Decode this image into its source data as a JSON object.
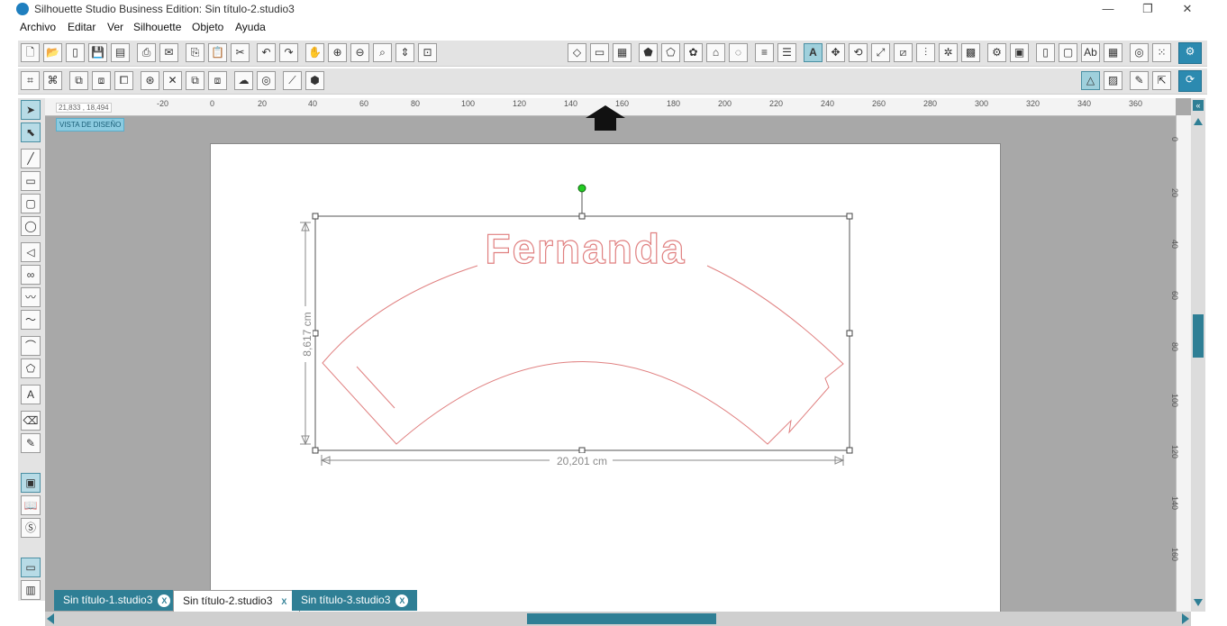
{
  "window": {
    "title": "Silhouette Studio Business Edition: Sin título-2.studio3",
    "minimize": "—",
    "restore": "❐",
    "close": "✕"
  },
  "menu": [
    "Archivo",
    "Editar",
    "Ver",
    "Silhouette",
    "Objeto",
    "Ayuda"
  ],
  "canvas": {
    "design_view_badge": "VISTA DE DISEÑO",
    "coords": "21,833 , 18,494",
    "ruler_h_labels": [
      "-20",
      "0",
      "20",
      "40",
      "60",
      "80",
      "100",
      "120",
      "140",
      "160",
      "180",
      "200",
      "220",
      "240",
      "260",
      "280",
      "300",
      "320",
      "340",
      "360"
    ],
    "ruler_v_labels": [
      "0",
      "20",
      "40",
      "60",
      "80",
      "100",
      "120",
      "140",
      "160"
    ],
    "width_dim": "20,201 cm",
    "height_dim": "8,617 cm",
    "shape_text": "Fernanda",
    "accent_color": "#2f7f95",
    "cut_line_color": "#e08080"
  },
  "tabs": [
    {
      "label": "Sin título-1.studio3",
      "active": false
    },
    {
      "label": "Sin título-2.studio3",
      "active": true
    },
    {
      "label": "Sin título-3.studio3",
      "active": false
    }
  ],
  "tab_close": "X"
}
